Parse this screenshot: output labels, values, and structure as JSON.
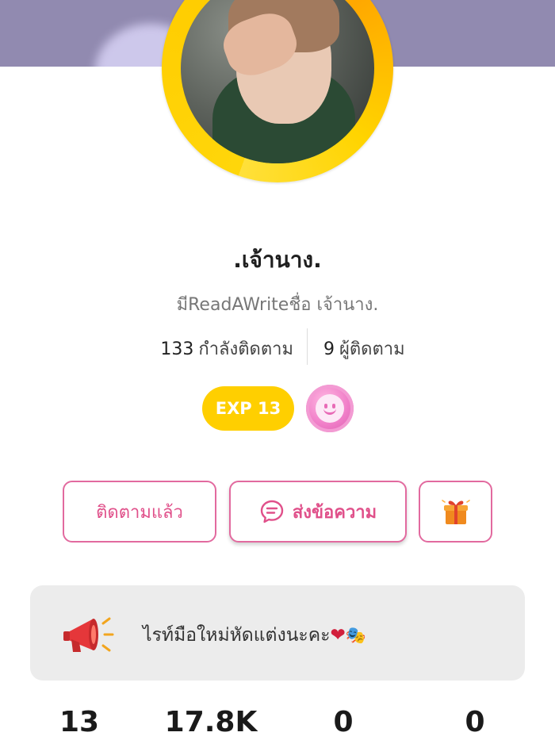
{
  "profile": {
    "display_name": ".เจ้านาง.",
    "subtitle": "มีReadAWriteชื่อ เจ้านาง.",
    "following_count": "133",
    "following_label": "กำลังติดตาม",
    "followers_count": "9",
    "followers_label": "ผู้ติดตาม",
    "exp_label": "EXP 13",
    "mood_icon": "smiley-face-icon"
  },
  "actions": {
    "follow_label": "ติดตามแล้ว",
    "message_label": "ส่งข้อความ",
    "gift_icon": "gift-box-icon"
  },
  "bio": {
    "text": "ไรท์มือใหม่หัดแต่งนะคะ",
    "emoji_heart": "❤",
    "emoji_masks": "🎭",
    "icon": "megaphone-icon"
  },
  "stats": [
    "13",
    "17.8K",
    "0",
    "0"
  ],
  "colors": {
    "cover": "#918ab0",
    "avatar_ring": "#ffcc00",
    "exp_badge": "#ffcf00",
    "accent_pink": "#e0508a",
    "mood_badge": "#f07ec8",
    "bio_background": "#ececec"
  }
}
